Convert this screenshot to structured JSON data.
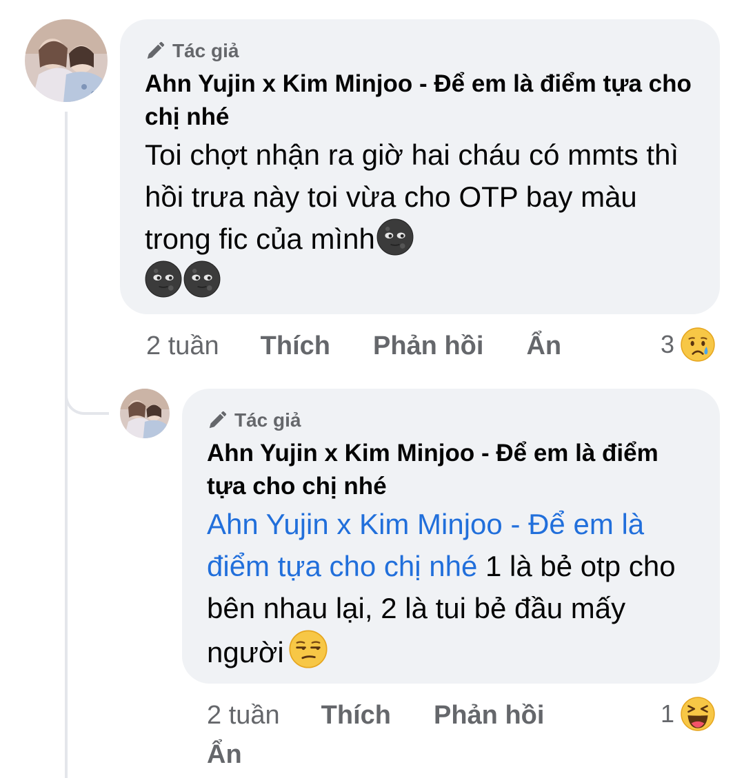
{
  "comments": [
    {
      "author_badge": "Tác giả",
      "author_name": "Ahn Yujin x Kim Minjoo - Để em là điểm tựa cho chị nhé",
      "text": "Toi chợt nhận ra giờ hai cháu có mmts thì hồi trưa này toi vừa cho OTP bay màu trong fic của mình",
      "emoji_icons": [
        "new-moon-face-icon",
        "new-moon-face-icon",
        "new-moon-face-icon"
      ],
      "time": "2 tuần",
      "like_label": "Thích",
      "reply_label": "Phản hồi",
      "hide_label": "Ẩn",
      "reaction_count": "3",
      "reaction_icon": "sad-reaction-icon"
    },
    {
      "author_badge": "Tác giả",
      "author_name": "Ahn Yujin x Kim Minjoo - Để em là điểm tựa cho chị nhé",
      "mention": "Ahn Yujin x Kim Minjoo - Để em là điểm tựa cho chị nhé",
      "text": " 1 là bẻ otp cho bên nhau lại, 2 là tui bẻ đầu mấy người",
      "emoji_icons": [
        "unamused-face-icon"
      ],
      "time": "2 tuần",
      "like_label": "Thích",
      "reply_label": "Phản hồi",
      "hide_label": "Ẩn",
      "reaction_count": "1",
      "reaction_icon": "haha-reaction-icon"
    }
  ],
  "colors": {
    "bubble": "#f0f2f5",
    "secondary_text": "#65676b",
    "mention": "#216fdb",
    "thread_line": "#e4e6eb"
  }
}
